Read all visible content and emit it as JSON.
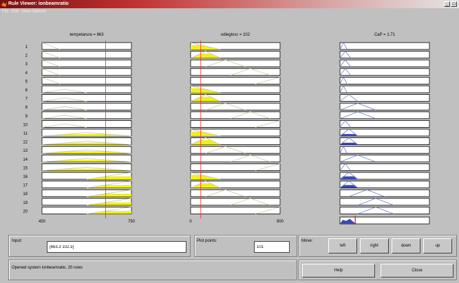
{
  "window": {
    "title": "Rule Viewer: ionbeamratio"
  },
  "menu": [
    "File",
    "Edit",
    "View",
    "Options"
  ],
  "inputs": [
    {
      "label": "tempetarura = 663",
      "min": 450,
      "max": 750,
      "value": 663.3,
      "mfs": [
        [
          [
            450,
            1
          ],
          [
            510,
            0
          ]
        ],
        [
          [
            450,
            0
          ],
          [
            525,
            0.5
          ],
          [
            600,
            0
          ]
        ],
        [
          [
            450,
            0
          ],
          [
            600,
            0.5
          ],
          [
            750,
            0
          ]
        ],
        [
          [
            600,
            0
          ],
          [
            750,
            1
          ]
        ]
      ]
    },
    {
      "label": "odleglosc = 102",
      "min": 0,
      "max": 900,
      "value": 102.3,
      "mfs": [
        [
          [
            0,
            1
          ],
          [
            300,
            0
          ]
        ],
        [
          [
            0,
            0
          ],
          [
            150,
            1
          ],
          [
            300,
            0
          ]
        ],
        [
          [
            150,
            0
          ],
          [
            350,
            1
          ],
          [
            550,
            0
          ]
        ],
        [
          [
            400,
            0
          ],
          [
            600,
            1
          ],
          [
            800,
            0
          ]
        ],
        [
          [
            650,
            0
          ],
          [
            900,
            1
          ]
        ]
      ]
    }
  ],
  "output": {
    "label": "CaP = 1.71",
    "min": 0,
    "max": 10,
    "value": 1.71,
    "mfs": [
      [
        [
          0,
          0
        ],
        [
          0.4,
          1
        ],
        [
          0.8,
          0
        ]
      ],
      [
        [
          0,
          0
        ],
        [
          1,
          1
        ],
        [
          2,
          0
        ]
      ],
      [
        [
          0,
          0
        ],
        [
          0.6,
          1
        ],
        [
          1.2,
          0
        ]
      ],
      [
        [
          0,
          0
        ],
        [
          2,
          1
        ],
        [
          4,
          0
        ]
      ],
      [
        [
          1,
          0
        ],
        [
          3,
          1
        ],
        [
          5,
          0
        ]
      ],
      [
        [
          2,
          0
        ],
        [
          4,
          1
        ],
        [
          6,
          0
        ]
      ]
    ]
  },
  "rules": [
    {
      "n": "1",
      "a": 0,
      "b": 0,
      "c": 0
    },
    {
      "n": "2",
      "a": 0,
      "b": 1,
      "c": 2
    },
    {
      "n": "3",
      "a": 0,
      "b": 2,
      "c": 2
    },
    {
      "n": "4",
      "a": 0,
      "b": 3,
      "c": 2
    },
    {
      "n": "5",
      "a": 0,
      "b": 4,
      "c": 0
    },
    {
      "n": "6",
      "a": 1,
      "b": 0,
      "c": 0
    },
    {
      "n": "7",
      "a": 1,
      "b": 1,
      "c": 1
    },
    {
      "n": "8",
      "a": 1,
      "b": 2,
      "c": 3
    },
    {
      "n": "9",
      "a": 1,
      "b": 3,
      "c": 3
    },
    {
      "n": "10",
      "a": 1,
      "b": 4,
      "c": 2
    },
    {
      "n": "11",
      "a": 2,
      "b": 0,
      "c": 1
    },
    {
      "n": "12",
      "a": 2,
      "b": 1,
      "c": 1
    },
    {
      "n": "13",
      "a": 2,
      "b": 2,
      "c": 0
    },
    {
      "n": "14",
      "a": 2,
      "b": 3,
      "c": 3
    },
    {
      "n": "15",
      "a": 2,
      "b": 4,
      "c": 2
    },
    {
      "n": "16",
      "a": 3,
      "b": 0,
      "c": 1
    },
    {
      "n": "17",
      "a": 3,
      "b": 1,
      "c": 1
    },
    {
      "n": "18",
      "a": 3,
      "b": 2,
      "c": 4
    },
    {
      "n": "19",
      "a": 3,
      "b": 3,
      "c": 5
    },
    {
      "n": "20",
      "a": 3,
      "b": 4,
      "c": 5
    }
  ],
  "aggregate": [
    [
      0,
      0
    ],
    [
      0.3,
      0.6
    ],
    [
      0.7,
      0.45
    ],
    [
      1.1,
      0.75
    ],
    [
      1.6,
      0.2
    ],
    [
      2,
      0
    ]
  ],
  "axis": {
    "in1_min": "450",
    "in1_max": "750",
    "in2_min": "0",
    "in2_max": "900"
  },
  "controls": {
    "input_label": "Input:",
    "input_value": "[663.3 102.3]",
    "plot_points_label": "Plot points:",
    "plot_points_value": "101",
    "move_label": "Move:",
    "left": "left",
    "right": "right",
    "down": "down",
    "up": "up",
    "help": "Help",
    "close": "Close",
    "status": "Opened system ionbeamratio, 20 rules"
  },
  "colors": {
    "mf_line": "#c8c8a0",
    "fill": "#f0f01c",
    "marker": "#ff2020",
    "out_line": "#6e7dc8",
    "out_fill": "#3a4ab4"
  }
}
